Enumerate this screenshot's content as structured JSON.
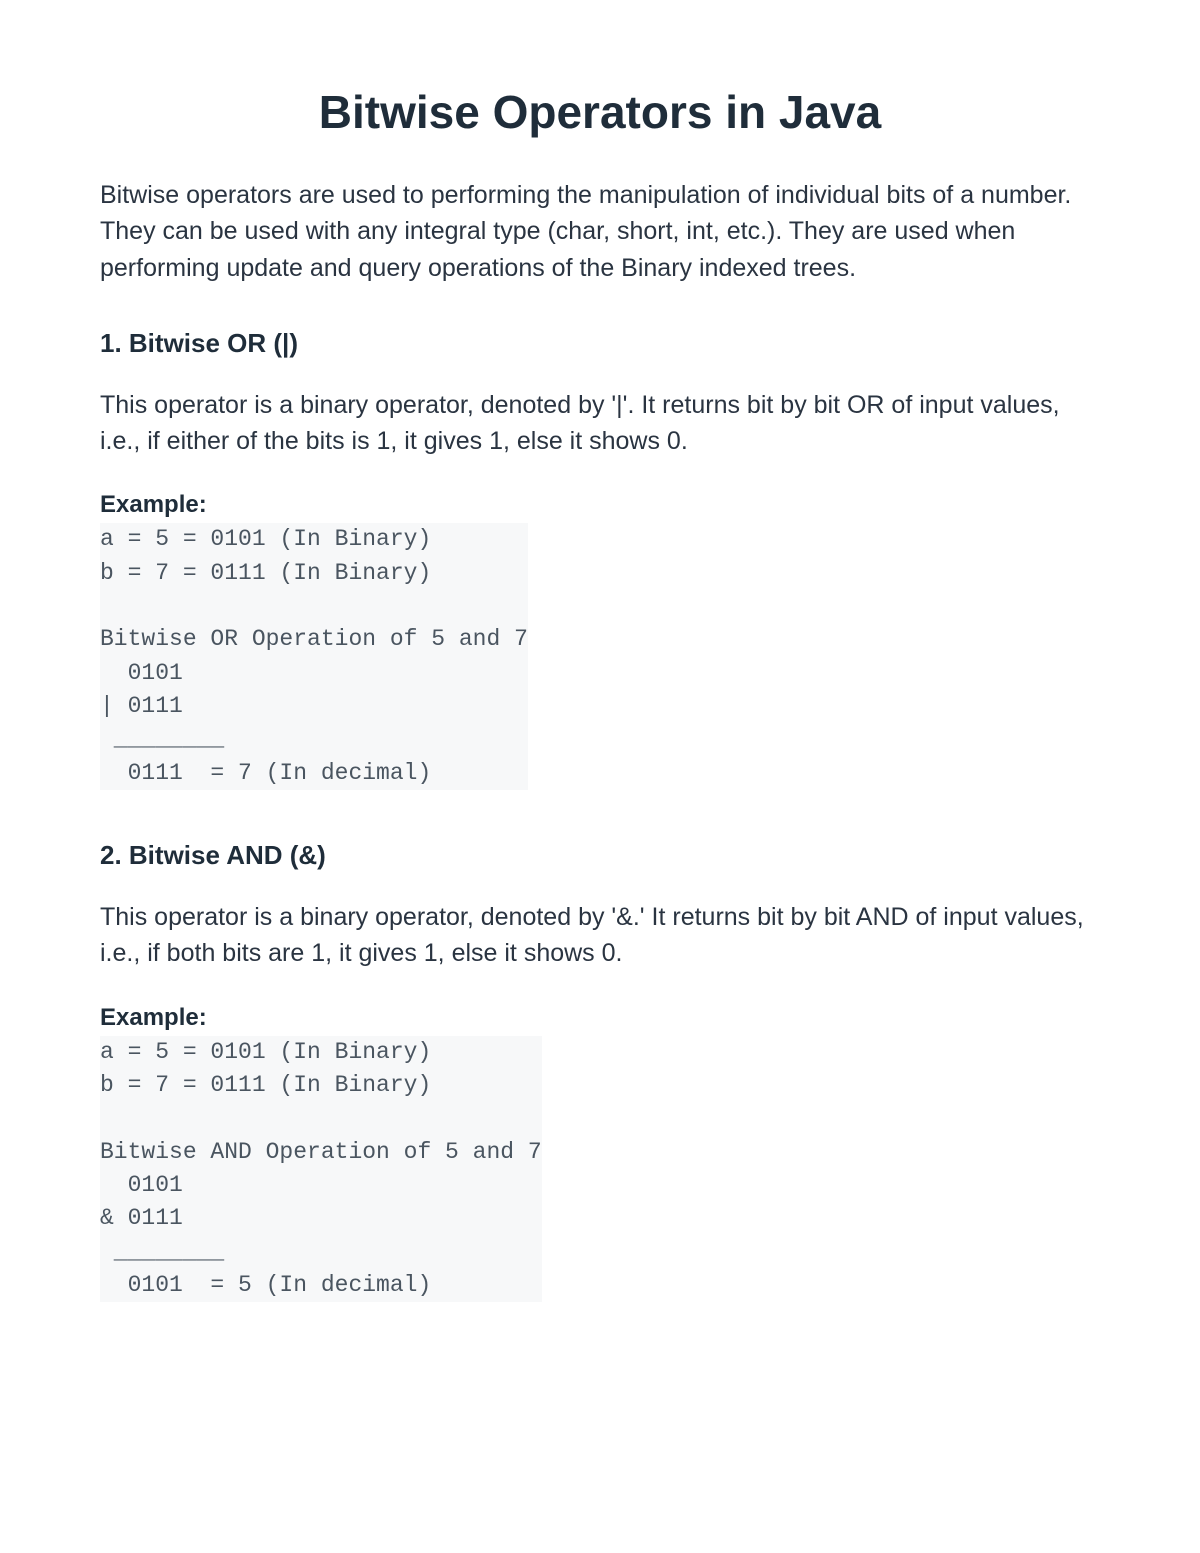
{
  "title": "Bitwise Operators in Java",
  "intro": "Bitwise operators are used to performing the manipulation of individual bits of a number. They can be used with any integral type (char, short, int, etc.). They are used when performing update and query operations of the Binary indexed trees.",
  "sections": [
    {
      "heading": "1. Bitwise OR (|)",
      "desc": "This operator is a binary operator, denoted by '|'. It returns bit by bit OR of input values, i.e., if either of the bits is 1, it gives 1, else it shows 0.",
      "example_label": "Example:",
      "code": "a = 5 = 0101 (In Binary)\nb = 7 = 0111 (In Binary)\n\nBitwise OR Operation of 5 and 7\n  0101\n| 0111\n ________\n  0111  = 7 (In decimal) "
    },
    {
      "heading": "2. Bitwise AND (&)",
      "desc": "This operator is a binary operator, denoted by '&.' It returns bit by bit AND of input values, i.e., if both bits are 1, it gives 1, else it shows 0.",
      "example_label": "Example:",
      "code": "a = 5 = 0101 (In Binary)\nb = 7 = 0111 (In Binary)\n\nBitwise AND Operation of 5 and 7\n  0101\n& 0111\n ________\n  0101  = 5 (In decimal) "
    }
  ]
}
